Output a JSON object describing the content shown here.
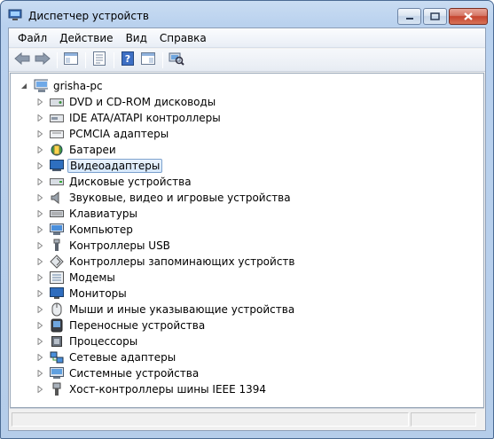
{
  "window": {
    "title": "Диспетчер устройств"
  },
  "menu": [
    "Файл",
    "Действие",
    "Вид",
    "Справка"
  ],
  "toolbar": {
    "buttons": [
      "back-icon",
      "forward-icon",
      "show-hide-tree-icon",
      "properties-icon",
      "help-icon",
      "show-hide-action-pane-icon",
      "scan-hardware-icon"
    ]
  },
  "tree": {
    "root": "grisha-pc",
    "categories": [
      {
        "label": "DVD и CD-ROM дисководы",
        "icon": "dvd-drive-icon"
      },
      {
        "label": "IDE ATA/ATAPI контроллеры",
        "icon": "ide-controller-icon"
      },
      {
        "label": "PCMCIA адаптеры",
        "icon": "pcmcia-icon"
      },
      {
        "label": "Батареи",
        "icon": "battery-icon"
      },
      {
        "label": "Видеоадаптеры",
        "icon": "display-adapter-icon"
      },
      {
        "label": "Дисковые устройства",
        "icon": "disk-drive-icon"
      },
      {
        "label": "Звуковые, видео и игровые устройства",
        "icon": "sound-icon"
      },
      {
        "label": "Клавиатуры",
        "icon": "keyboard-icon"
      },
      {
        "label": "Компьютер",
        "icon": "computer-icon"
      },
      {
        "label": "Контроллеры USB",
        "icon": "usb-icon"
      },
      {
        "label": "Контроллеры запоминающих устройств",
        "icon": "storage-controller-icon"
      },
      {
        "label": "Модемы",
        "icon": "modem-icon"
      },
      {
        "label": "Мониторы",
        "icon": "monitor-icon"
      },
      {
        "label": "Мыши и иные указывающие устройства",
        "icon": "mouse-icon"
      },
      {
        "label": "Переносные устройства",
        "icon": "portable-device-icon"
      },
      {
        "label": "Процессоры",
        "icon": "processor-icon"
      },
      {
        "label": "Сетевые адаптеры",
        "icon": "network-adapter-icon"
      },
      {
        "label": "Системные устройства",
        "icon": "system-device-icon"
      },
      {
        "label": "Хост-контроллеры шины IEEE 1394",
        "icon": "ieee1394-icon"
      }
    ],
    "selected_index": 4
  }
}
